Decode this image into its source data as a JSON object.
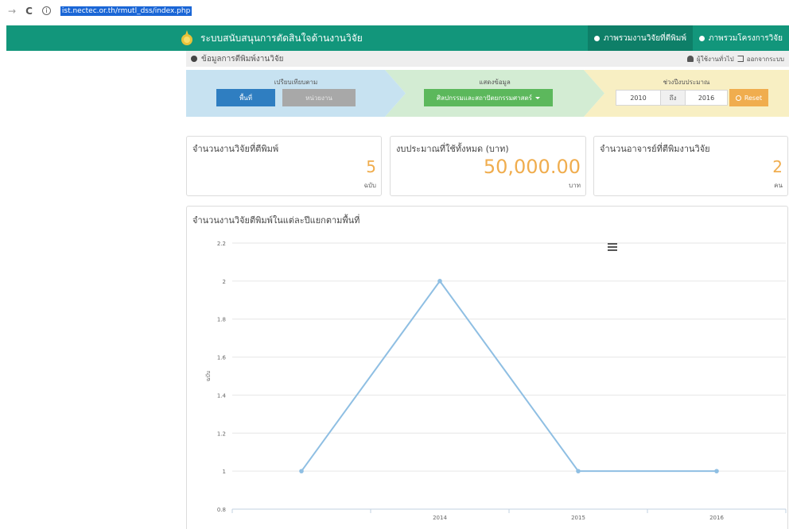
{
  "browser": {
    "back_glyph": "→",
    "reload_glyph": "C",
    "info_glyph": "i",
    "url": "ist.nectec.or.th/rmutl_dss/index.php"
  },
  "header": {
    "title": "ระบบสนับสนุนการตัดสินใจด้านงานวิจัย",
    "nav": [
      {
        "label": "ภาพรวมงานวิจัยที่ตีพิมพ์",
        "active": true
      },
      {
        "label": "ภาพรวมโครงการวิจัย",
        "active": false
      }
    ],
    "brand_color": "#12967b"
  },
  "subheader": {
    "title": "ข้อมูลการตีพิมพ์งานวิจัย",
    "user": "ผู้ใช้งานทั่วไป",
    "logout": "ออกจากระบบ"
  },
  "filters": {
    "compare": {
      "title": "เปรียบเทียบตาม",
      "area_label": "พื้นที่",
      "unit_label": "หน่วยงาน"
    },
    "display": {
      "title": "แสดงข้อมูล",
      "faculty_label": "ศิลปกรรมและสถาปัตยกรรมศาสตร์"
    },
    "budget_year": {
      "title": "ช่วงปีงบประมาณ",
      "from": "2010",
      "to_label": "ถึง",
      "to": "2016",
      "reset_label": "Reset"
    }
  },
  "stats": [
    {
      "title": "จำนวนงานวิจัยที่ตีพิมพ์",
      "value": "5",
      "unit": "ฉบับ"
    },
    {
      "title": "งบประมาณที่ใช้ทั้งหมด (บาท)",
      "value": "50,000.00",
      "unit": "บาท"
    },
    {
      "title": "จำนวนอาจารย์ที่ตีพิมงานวิจัย",
      "value": "2",
      "unit": "คน"
    }
  ],
  "chart_panel": {
    "title": "จำนวนงานวิจัยตีพิมพ์ในแต่ละปีแยกตามพื้นที่"
  },
  "chart_data": {
    "type": "line",
    "x": [
      "",
      "2014",
      "2015",
      "2016"
    ],
    "tick_labels": [
      "2014",
      "2015",
      "2016"
    ],
    "series": [
      {
        "values": [
          1,
          2,
          1,
          1
        ],
        "color": "#8fbfe3"
      }
    ],
    "ylabel": "ฉบับ",
    "ylim": [
      0.8,
      2.2
    ],
    "yticks": [
      0.8,
      1,
      1.2,
      1.4,
      1.6,
      1.8,
      2,
      2.2
    ],
    "grid": true,
    "value_color": "#f0ad4e"
  }
}
